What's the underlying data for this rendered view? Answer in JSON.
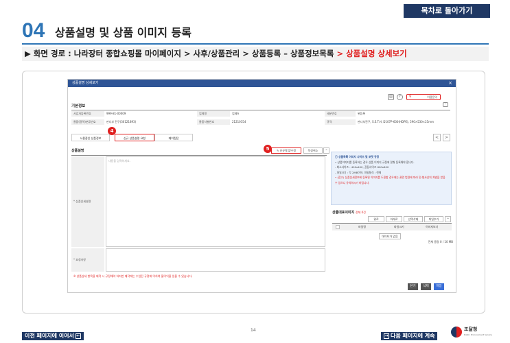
{
  "header": {
    "back_to_toc": "목차로 돌아가기",
    "section_number": "04",
    "section_title": "상품설명 및 상품 이미지 등록",
    "path_prefix": "▶ 화면 경로 : 나라장터 종합쇼핑몰 마이페이지 > 사후/상품관리 > 상품등록 – 상품정보목록",
    "path_current": "> 상품설명 상세보기"
  },
  "window": {
    "title": "상품설명 상세보기",
    "close": "×",
    "search_placeholder": "이용문의",
    "basic_info_title": "기본정보",
    "rows": [
      [
        "사업자등록번호",
        "999-81-00009",
        "업체명",
        "업체A",
        "세분번호",
        "위등록"
      ],
      [
        "물품(용역)분류번호",
        "판다부 전구(30121893)",
        "물품식별번호",
        "21210354",
        "규격",
        "판다부전구, S.E.T.H, D107P-600(HDPE), 590×530×25mm"
      ]
    ],
    "tabs": [
      "사용중인 상품정보",
      "신규 상품설명 요청",
      "메이킹탑"
    ],
    "prev_icon": "<",
    "next_icon": ">",
    "desc_title": "상품설명",
    "edit_request_btn": "신규작업/수정",
    "edit_only_btn": "작성취소",
    "desc_label": "* 상품상세설명",
    "desc_placeholder": "내용을 입력하세요.",
    "notes_label": "* 요청사항",
    "warning": "※ 상품상세 항목을 제작 시 규정해야 하지만 제작에는 수입된 규정에 이하여 불이익을 있을 수 있습니다.",
    "info": {
      "title": "상품목록 이미지 사이즈 및 포맷 규정",
      "lines": [
        "• 상품이미지를 등록하는 경우 상품 이미지 규정에 맞춰 등록해야 합니다.",
        "- 최소사이즈 : 400x400, 권장사이즈 600x600",
        "- 파일크기 : 각 2MB이하, 파일형식 : 전체"
      ],
      "note": "• (참고) 상품상세정보에 등록된 이미지를 도용할 경우에는 관련 법령에 따라 민·형사상의 처벌을 받을 수 있으니 유의하시기 바랍니다."
    },
    "rep_title": "상품대표이미지",
    "rep_sub": "전체 0건",
    "rep_buttons": [
      "위로",
      "아래로",
      "선택삭제",
      "파일추가"
    ],
    "grid_headers": [
      "파일명",
      "파일크기",
      "이미지보기"
    ],
    "no_data": "데이터가 없음",
    "total": "전체 용량 0 / 10 MB",
    "footer_buttons": [
      "닫기",
      "삭제",
      "저장"
    ]
  },
  "markers": {
    "tab_badge": "4",
    "edit_badge": "5"
  },
  "footer": {
    "prev_page": "이전 페이지에 이어서",
    "page_number": "14",
    "next_page": "다음 페이지에 계속",
    "logo_text": "조달청",
    "logo_sub": "Public Procurement Service"
  },
  "colors": {
    "navy": "#1f3864",
    "accent_blue": "#2e75b6",
    "red": "#e02020",
    "window_header": "#2f5596"
  }
}
